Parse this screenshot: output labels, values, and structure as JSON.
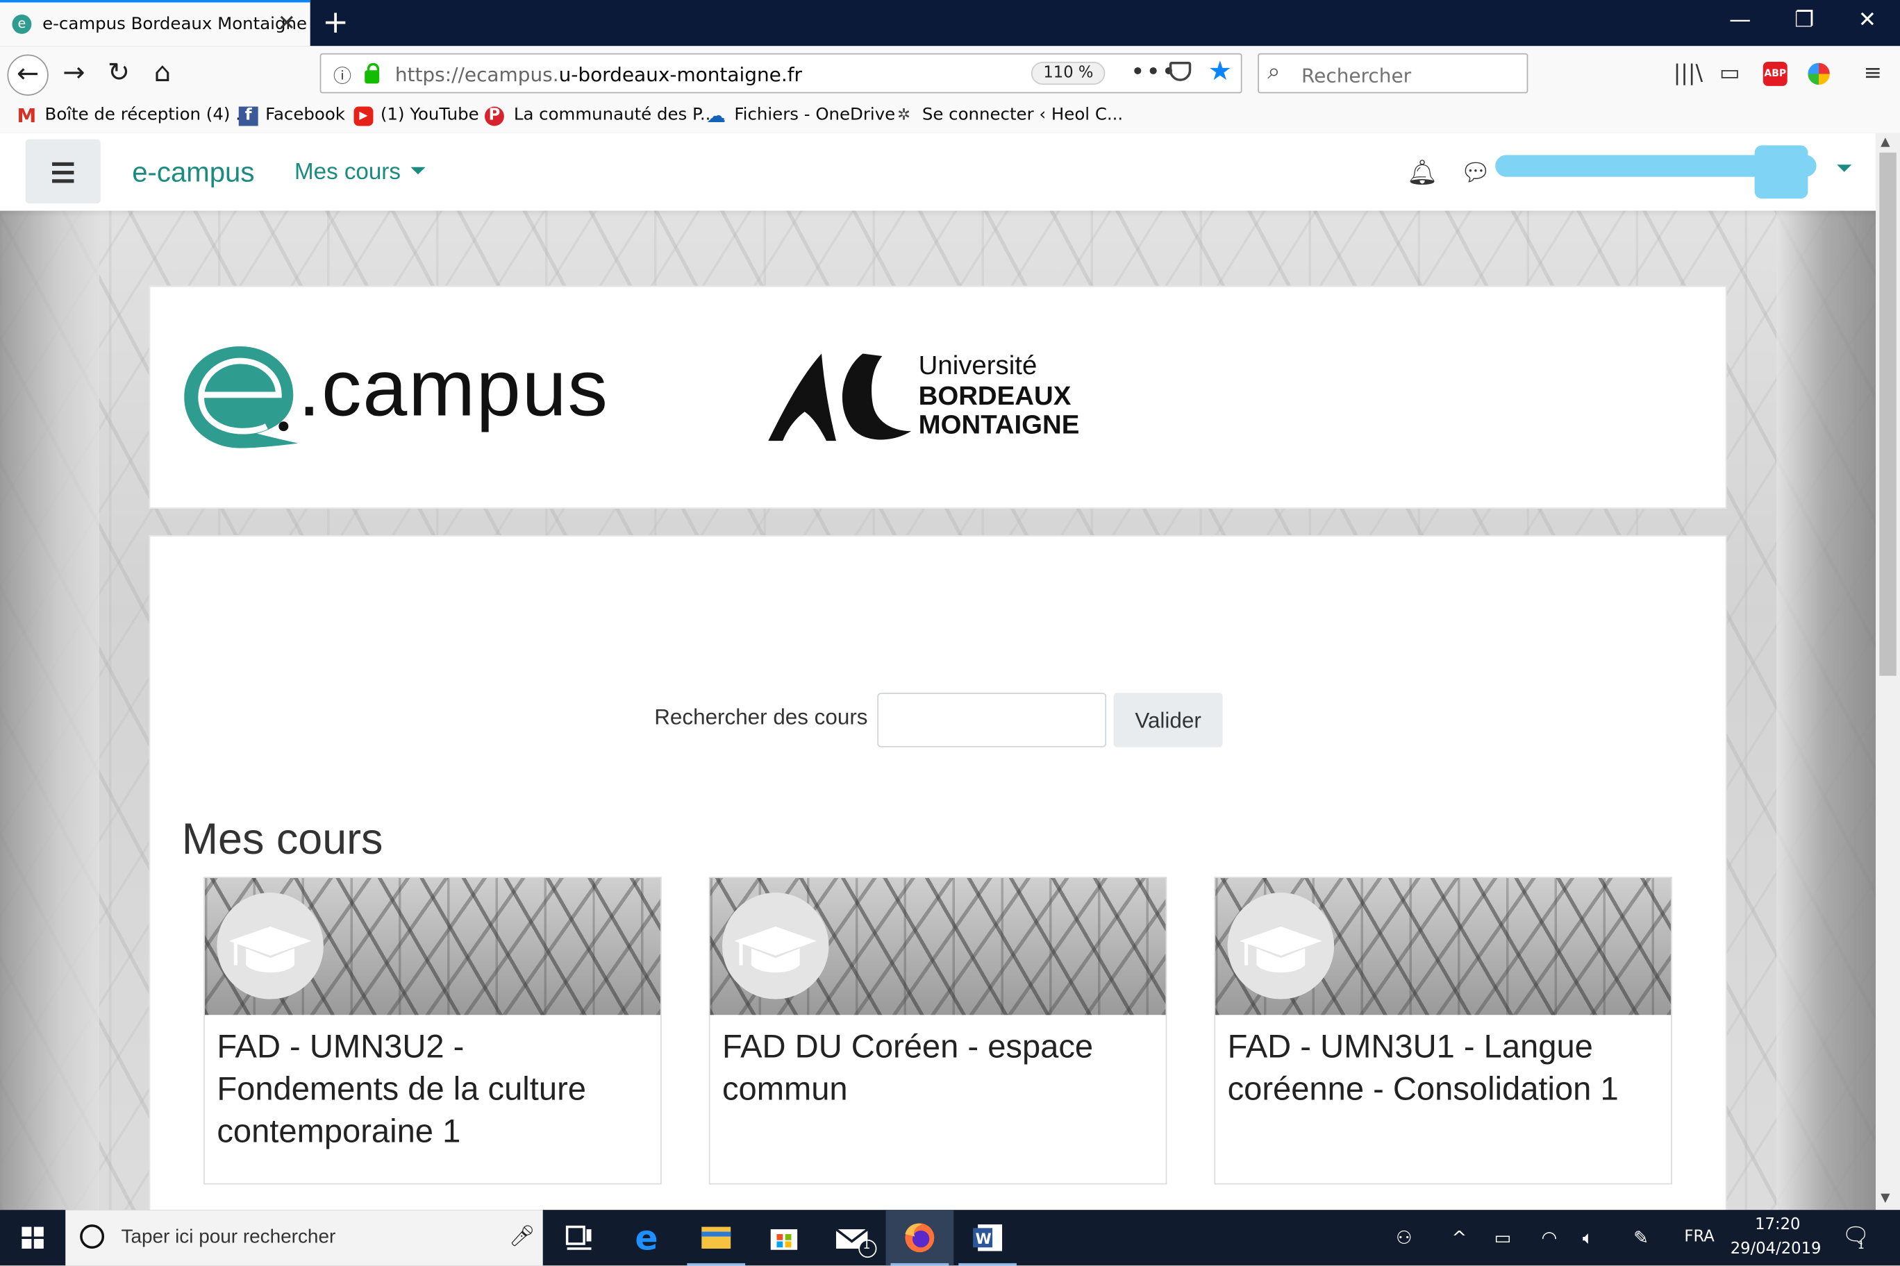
{
  "browser": {
    "tab_title": "e-campus Bordeaux Montaigne",
    "url_prefix": "https://ecampus.",
    "url_domain": "u-bordeaux-montaigne.fr",
    "zoom": "110 %",
    "search_placeholder": "Rechercher",
    "bookmarks": [
      {
        "label": "Boîte de réception (4) ...",
        "icon": "gmail-icon"
      },
      {
        "label": "Facebook",
        "icon": "facebook-icon"
      },
      {
        "label": "(1) YouTube",
        "icon": "youtube-icon"
      },
      {
        "label": "La communauté des P...",
        "icon": "pinterest-icon"
      },
      {
        "label": "Fichiers - OneDrive",
        "icon": "onedrive-icon"
      },
      {
        "label": "Se connecter ‹ Heol C...",
        "icon": "heol-icon"
      }
    ],
    "abp_label": "ABP"
  },
  "site": {
    "brand": "e-campus",
    "menu_courses": "Mes cours",
    "logo_ecampus_text": ".campus",
    "logo_ubm_line1": "Université",
    "logo_ubm_line2": "BORDEAUX",
    "logo_ubm_line3": "MONTAIGNE",
    "search_label": "Rechercher des cours",
    "search_button": "Valider",
    "my_courses_heading": "Mes cours",
    "courses": [
      {
        "title": "FAD - UMN3U2 - Fondements de la culture contemporaine 1"
      },
      {
        "title": "FAD DU Coréen - espace commun"
      },
      {
        "title": "FAD - UMN3U1 - Langue coréenne - Consolidation 1"
      }
    ]
  },
  "taskbar": {
    "search_placeholder": "Taper ici pour rechercher",
    "language": "FRA",
    "time": "17:20",
    "date": "29/04/2019",
    "mail_badge": "1",
    "notif_badge": "1"
  },
  "colors": {
    "accent": "#1a8c7f",
    "ecampus_teal": "#2e9c8f",
    "firefox_blue": "#0a84ff",
    "redaction": "#7fd3f5"
  }
}
